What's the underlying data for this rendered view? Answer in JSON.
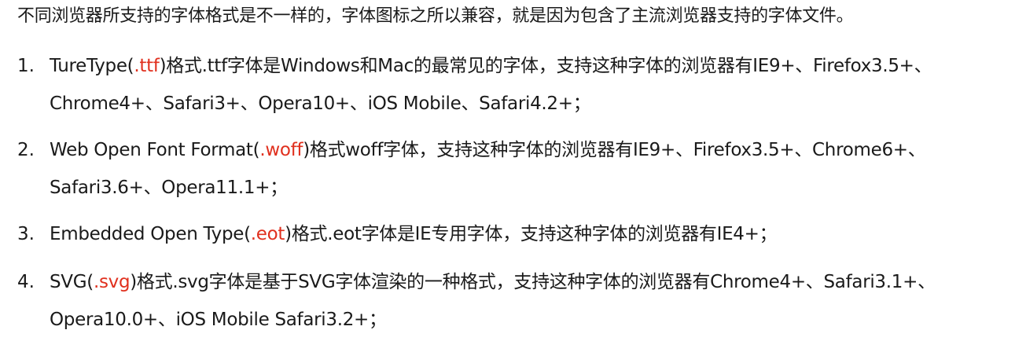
{
  "intro": "不同浏览器所支持的字体格式是不一样的，字体图标之所以兼容，就是因为包含了主流浏览器支持的字体文件。",
  "items": [
    {
      "number": "1.",
      "prefix": "TureType(",
      "ext": ".ttf",
      "suffix": ")格式.ttf字体是Windows和Mac的最常见的字体，支持这种字体的浏览器有IE9+、Firefox3.5+、",
      "line2": "Chrome4+、Safari3+、Opera10+、iOS Mobile、Safari4.2+；"
    },
    {
      "number": "2.",
      "prefix": "Web Open Font Format(",
      "ext": ".woff",
      "suffix": ")格式woff字体，支持这种字体的浏览器有IE9+、Firefox3.5+、Chrome6+、",
      "line2": "Safari3.6+、Opera11.1+；"
    },
    {
      "number": "3.",
      "prefix": "Embedded Open Type(",
      "ext": ".eot",
      "suffix": ")格式.eot字体是IE专用字体，支持这种字体的浏览器有IE4+；",
      "line2": ""
    },
    {
      "number": "4.",
      "prefix": "SVG(",
      "ext": ".svg",
      "suffix": ")格式.svg字体是基于SVG字体渲染的一种格式，支持这种字体的浏览器有Chrome4+、Safari3.1+、",
      "line2": "Opera10.0+、iOS Mobile Safari3.2+；"
    }
  ],
  "colors": {
    "text": "#1a1a1a",
    "extension_highlight": "#e0301e",
    "background": "#ffffff"
  }
}
